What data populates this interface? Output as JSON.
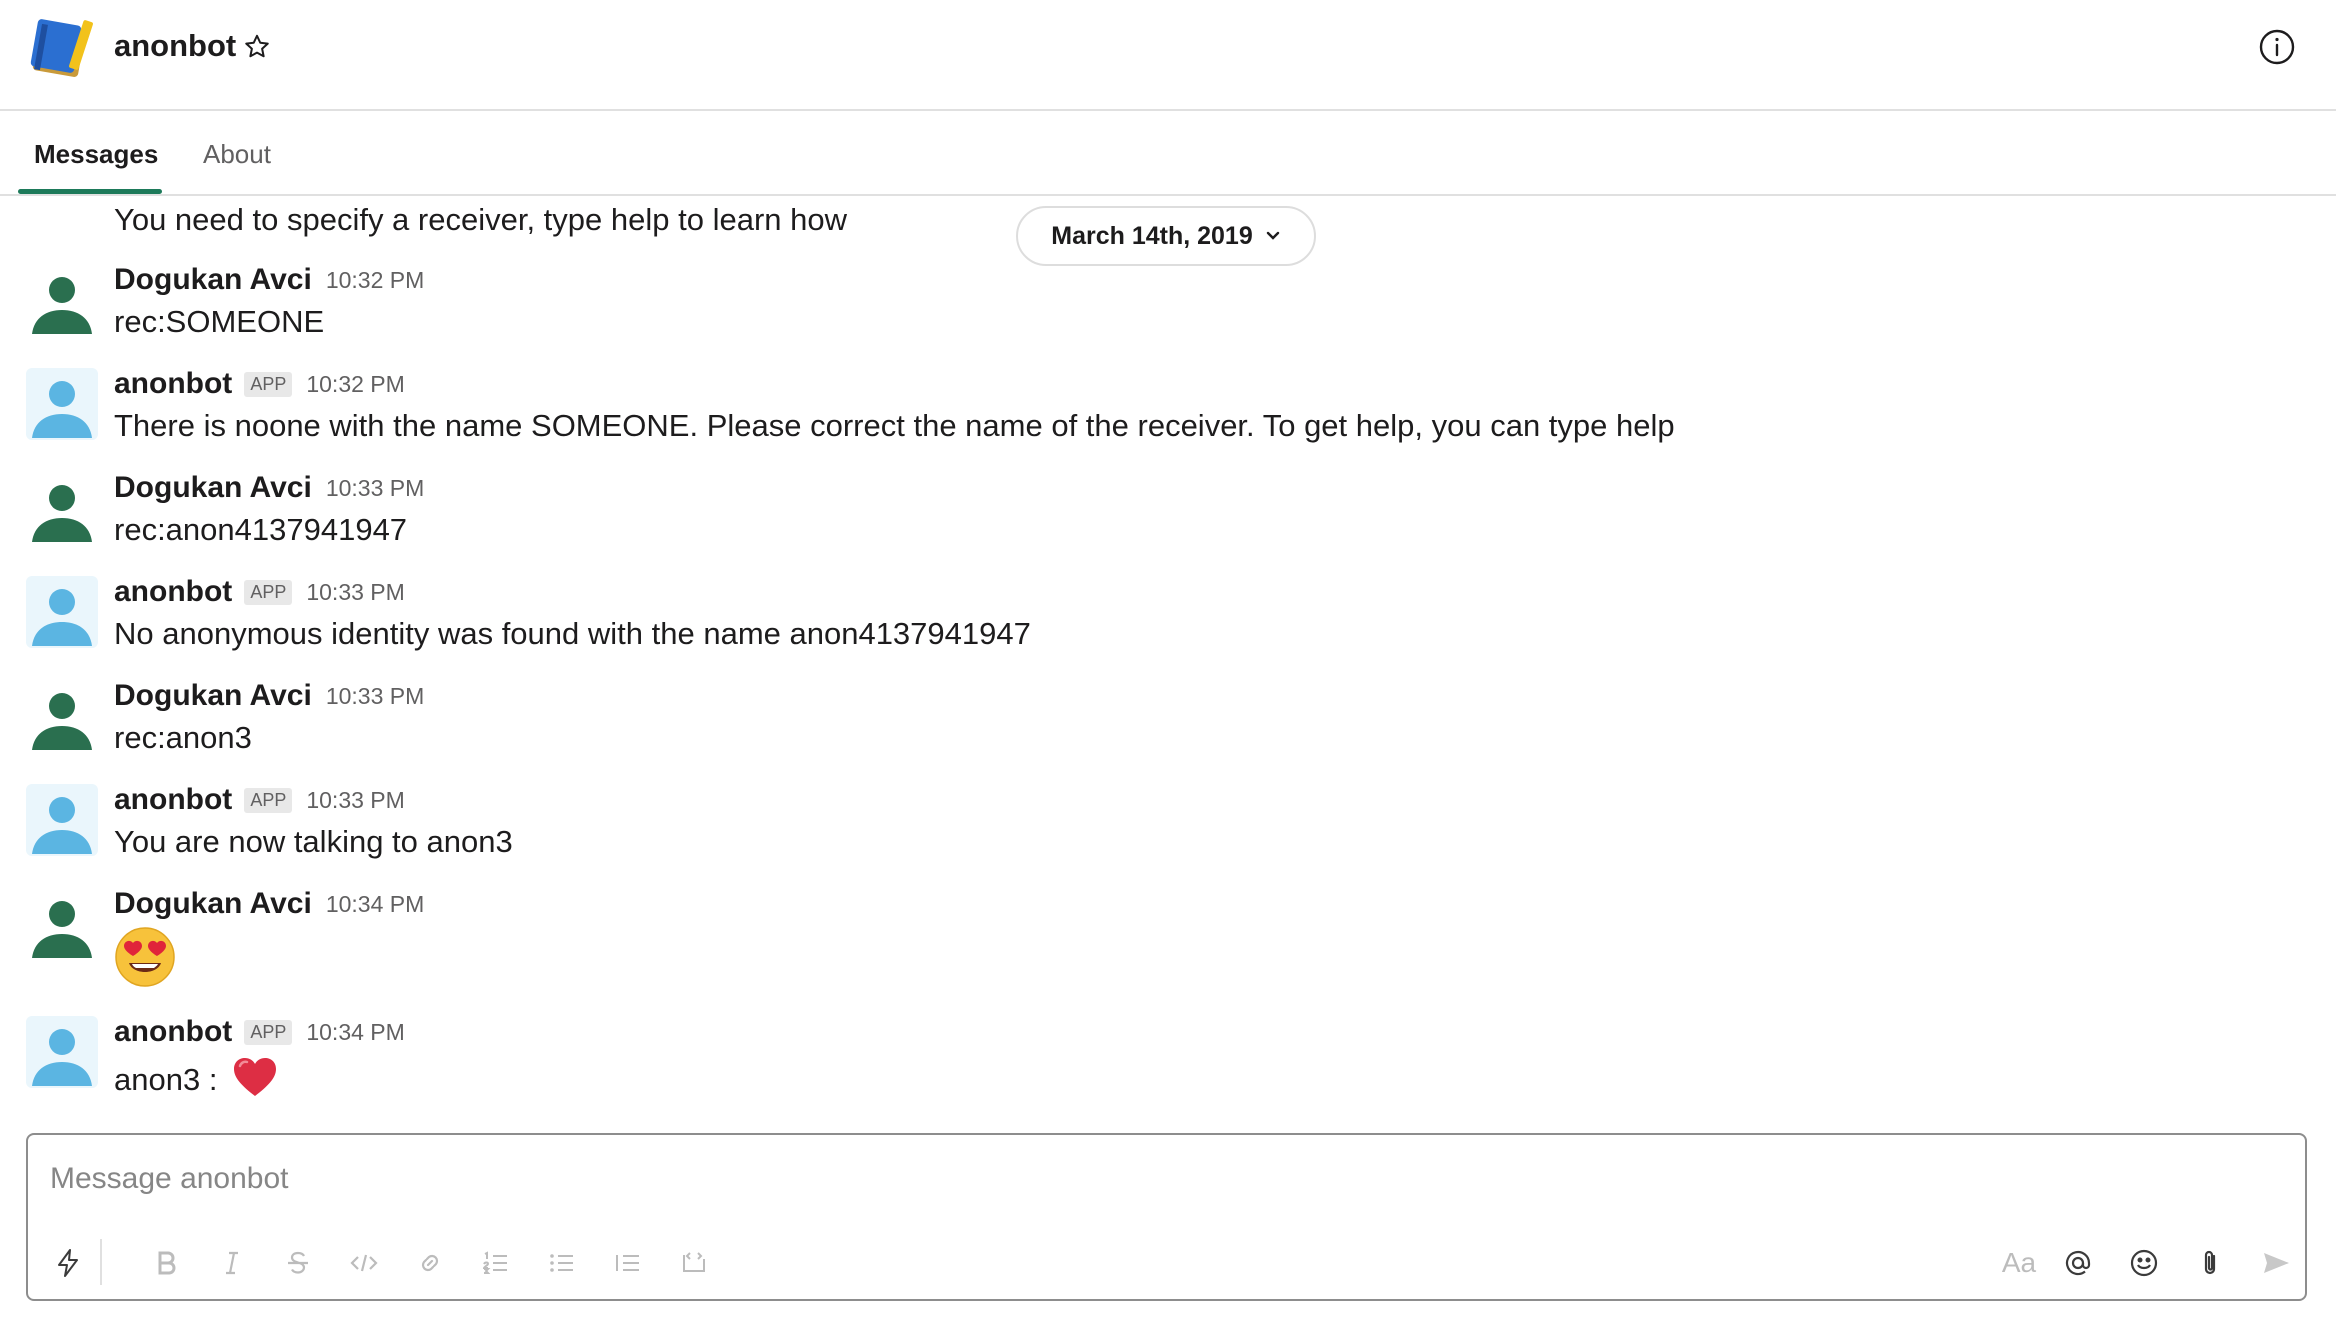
{
  "header": {
    "title": "anonbot",
    "logo_icon": "notebook-icon",
    "star_icon": "star-icon",
    "info_icon": "info-icon"
  },
  "tabs": [
    {
      "label": "Messages",
      "active": true
    },
    {
      "label": "About",
      "active": false
    }
  ],
  "date_divider": "March 14th, 2019",
  "top_message_text": "You need to specify a receiver, type help to learn how",
  "messages": [
    {
      "sender": "Dogukan Avci",
      "app": false,
      "badge": "",
      "time": "10:32 PM",
      "text": "rec:SOMEONE"
    },
    {
      "sender": "anonbot",
      "app": true,
      "badge": "APP",
      "time": "10:32 PM",
      "text": "There is noone with the name SOMEONE. Please correct the name of the receiver. To get help, you can type help"
    },
    {
      "sender": "Dogukan Avci",
      "app": false,
      "badge": "",
      "time": "10:33 PM",
      "text": "rec:anon4137941947"
    },
    {
      "sender": "anonbot",
      "app": true,
      "badge": "APP",
      "time": "10:33 PM",
      "text": "No anonymous identity was found with the name anon4137941947"
    },
    {
      "sender": "Dogukan Avci",
      "app": false,
      "badge": "",
      "time": "10:33 PM",
      "text": "rec:anon3"
    },
    {
      "sender": "anonbot",
      "app": true,
      "badge": "APP",
      "time": "10:33 PM",
      "text": "You are now talking to anon3"
    },
    {
      "sender": "Dogukan Avci",
      "app": false,
      "badge": "",
      "time": "10:34 PM",
      "text": "",
      "emoji": "heart-eyes-emoji"
    },
    {
      "sender": "anonbot",
      "app": true,
      "badge": "APP",
      "time": "10:34 PM",
      "text": "anon3 :",
      "emoji": "red-heart-emoji"
    }
  ],
  "colors": {
    "user_avatar": "#2a6f4f",
    "bot_avatar": "#5bb5e2",
    "tab_accent": "#1d7a5a"
  },
  "composer": {
    "placeholder": "Message anonbot",
    "value": "",
    "toolbar_left": [
      "shortcuts-icon",
      "bold-icon",
      "italic-icon",
      "strikethrough-icon",
      "code-icon",
      "link-icon",
      "ordered-list-icon",
      "bulleted-list-icon",
      "blockquote-icon",
      "code-block-icon"
    ],
    "toolbar_right": [
      "formatting-icon",
      "mention-icon",
      "emoji-icon",
      "attachment-icon",
      "send-icon"
    ],
    "format_label": "Aa"
  }
}
